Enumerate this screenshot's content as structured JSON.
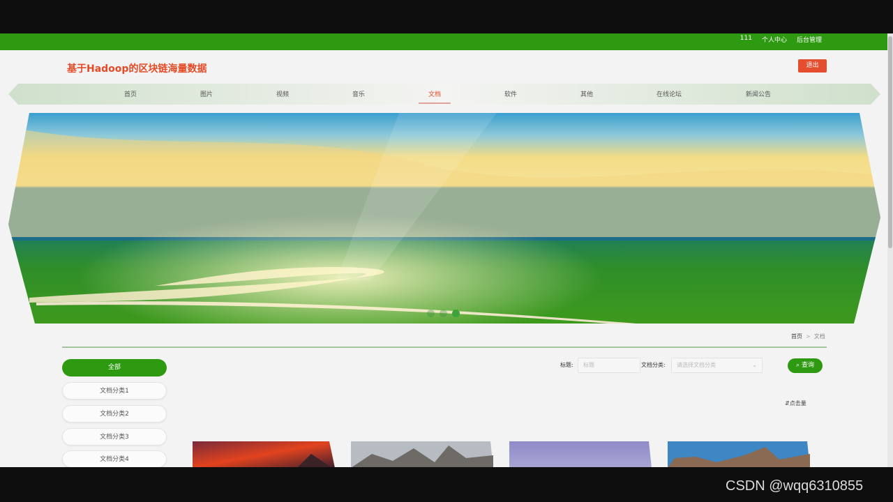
{
  "topbar": {
    "links": [
      "111",
      "个人中心",
      "后台管理"
    ]
  },
  "header": {
    "site_title": "基于Hadoop的区块链海量数据",
    "logout_label": "退出"
  },
  "nav": {
    "items": [
      "首页",
      "图片",
      "视频",
      "音乐",
      "文档",
      "软件",
      "其他",
      "在线论坛",
      "新闻公告"
    ],
    "active": "文档"
  },
  "breadcrumb": {
    "home": "首页",
    "separator": ">",
    "current": "文档"
  },
  "categories": [
    "全部",
    "文档分类1",
    "文档分类2",
    "文档分类3",
    "文档分类4"
  ],
  "search": {
    "title_label": "标题:",
    "title_placeholder": "标题",
    "category_label": "文档分类:",
    "category_placeholder": "请选择文档分类",
    "button_label": "查询"
  },
  "sort": {
    "label": "点击量"
  },
  "watermark": "CSDN @wqq6310855",
  "colors": {
    "brand_green": "#2e9a12",
    "title_red": "#e44b26",
    "logout_red": "#e54d2f"
  }
}
